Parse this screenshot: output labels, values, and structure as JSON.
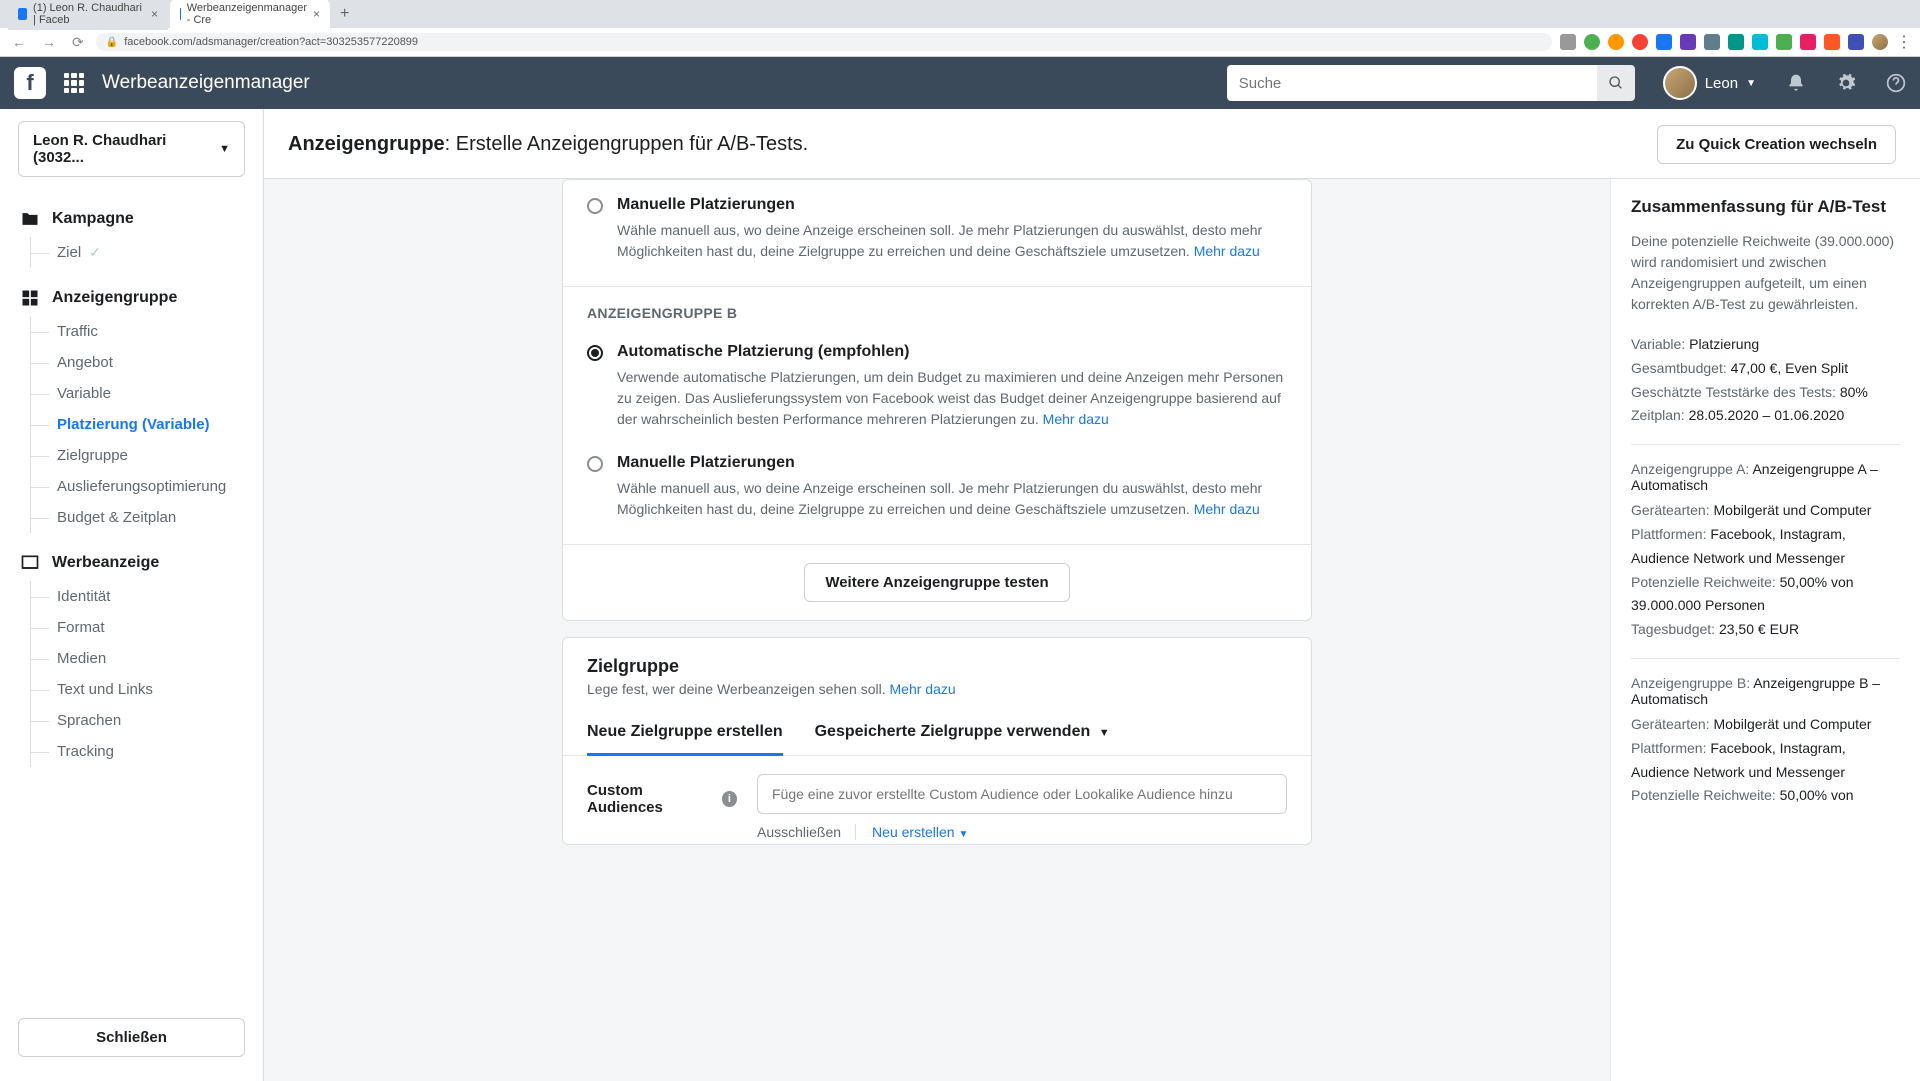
{
  "browser": {
    "tabs": [
      {
        "title": "(1) Leon R. Chaudhari | Faceb"
      },
      {
        "title": "Werbeanzeigenmanager - Cre"
      }
    ],
    "url": "facebook.com/adsmanager/creation?act=303253577220899"
  },
  "topnav": {
    "app_title": "Werbeanzeigenmanager",
    "search_placeholder": "Suche",
    "user_name": "Leon"
  },
  "sidebar": {
    "account": "Leon R. Chaudhari (3032...",
    "campaign": {
      "title": "Kampagne",
      "items": [
        "Ziel"
      ]
    },
    "adset": {
      "title": "Anzeigengruppe",
      "items": [
        "Traffic",
        "Angebot",
        "Variable",
        "Platzierung (Variable)",
        "Zielgruppe",
        "Auslieferungsoptimierung",
        "Budget & Zeitplan"
      ],
      "active_index": 3
    },
    "ad": {
      "title": "Werbeanzeige",
      "items": [
        "Identität",
        "Format",
        "Medien",
        "Text und Links",
        "Sprachen",
        "Tracking"
      ]
    },
    "close": "Schließen"
  },
  "header": {
    "title_bold": "Anzeigengruppe",
    "title_rest": ": Erstelle Anzeigengruppen für A/B-Tests.",
    "quick_creation": "Zu Quick Creation wechseln"
  },
  "placements": {
    "manual_a": {
      "title": "Manuelle Platzierungen",
      "desc": "Wähle manuell aus, wo deine Anzeige erscheinen soll. Je mehr Platzierungen du auswählst, desto mehr Möglichkeiten hast du, deine Zielgruppe zu erreichen und deine Geschäftsziele umzusetzen.",
      "more": "Mehr dazu"
    },
    "group_b_label": "ANZEIGENGRUPPE B",
    "auto_b": {
      "title": "Automatische Platzierung (empfohlen)",
      "desc": "Verwende automatische Platzierungen, um dein Budget zu maximieren und deine Anzeigen mehr Personen zu zeigen. Das Auslieferungssystem von Facebook weist das Budget deiner Anzeigengruppe basierend auf der wahrscheinlich besten Performance mehreren Platzierungen zu.",
      "more": "Mehr dazu"
    },
    "manual_b": {
      "title": "Manuelle Platzierungen",
      "desc": "Wähle manuell aus, wo deine Anzeige erscheinen soll. Je mehr Platzierungen du auswählst, desto mehr Möglichkeiten hast du, deine Zielgruppe zu erreichen und deine Geschäftsziele umzusetzen.",
      "more": "Mehr dazu"
    },
    "test_more": "Weitere Anzeigengruppe testen"
  },
  "audience": {
    "title": "Zielgruppe",
    "subtitle": "Lege fest, wer deine Werbeanzeigen sehen soll.",
    "more": "Mehr dazu",
    "tab_new": "Neue Zielgruppe erstellen",
    "tab_saved": "Gespeicherte Zielgruppe verwenden",
    "custom_label": "Custom Audiences",
    "custom_placeholder": "Füge eine zuvor erstellte Custom Audience oder Lookalike Audience hinzu",
    "exclude": "Ausschließen",
    "create_new": "Neu erstellen"
  },
  "summary": {
    "title": "Zusammenfassung für A/B-Test",
    "intro": "Deine potenzielle Reichweite (39.000.000) wird randomisiert und zwischen Anzeigengruppen aufgeteilt, um einen korrekten A/B-Test zu gewährleisten.",
    "variable_label": "Variable:",
    "variable_val": "Platzierung",
    "budget_label": "Gesamtbudget:",
    "budget_val": "47,00 €, Even Split",
    "power_label": "Geschätzte Teststärke des Tests:",
    "power_val": "80%",
    "schedule_label": "Zeitplan:",
    "schedule_val": "28.05.2020 – 01.06.2020",
    "groups": [
      {
        "head_label": "Anzeigengruppe A:",
        "head_val": "Anzeigengruppe A – Automatisch",
        "device_label": "Gerätearten:",
        "device_val": "Mobilgerät und Computer",
        "platform_label": "Plattformen:",
        "platform_val": "Facebook, Instagram, Audience Network und Messenger",
        "reach_label": "Potenzielle Reichweite:",
        "reach_val": "50,00% von 39.000.000 Personen",
        "daily_label": "Tagesbudget:",
        "daily_val": "23,50 € EUR"
      },
      {
        "head_label": "Anzeigengruppe B:",
        "head_val": "Anzeigengruppe B – Automatisch",
        "device_label": "Gerätearten:",
        "device_val": "Mobilgerät und Computer",
        "platform_label": "Plattformen:",
        "platform_val": "Facebook, Instagram, Audience Network und Messenger",
        "reach_label": "Potenzielle Reichweite:",
        "reach_val": "50,00% von"
      }
    ]
  }
}
